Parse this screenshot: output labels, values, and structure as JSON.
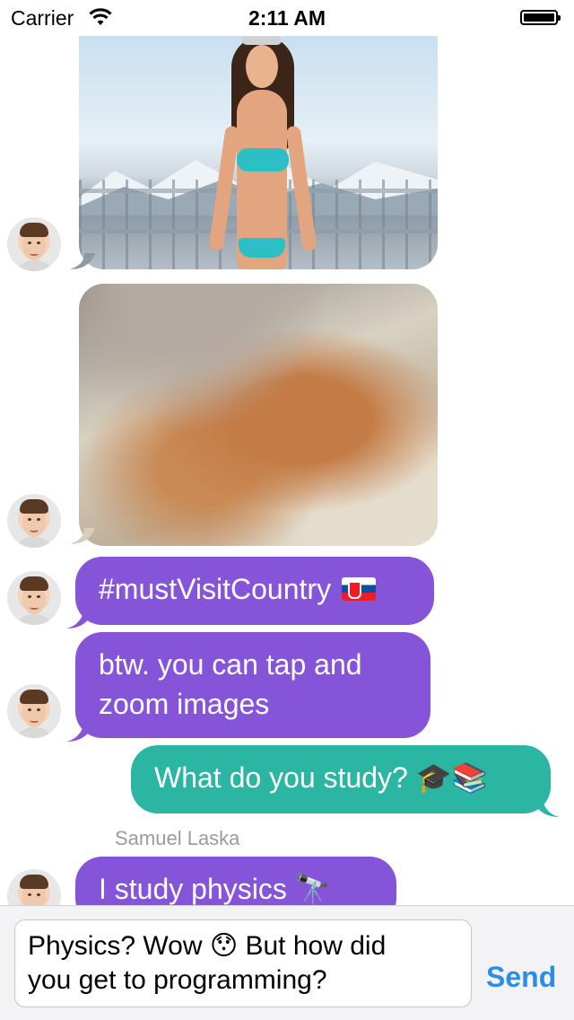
{
  "status_bar": {
    "carrier": "Carrier",
    "time": "2:11 AM",
    "icons": [
      "wifi-icon",
      "battery-icon"
    ]
  },
  "messages": [
    {
      "type": "image",
      "direction": "incoming",
      "subject": "skier-photo"
    },
    {
      "type": "image",
      "direction": "incoming",
      "subject": "food-photo"
    },
    {
      "type": "text",
      "direction": "incoming",
      "text": "#mustVisitCountry",
      "emoji": "slovakia-flag-icon"
    },
    {
      "type": "text",
      "direction": "incoming",
      "line1": "btw. you can tap and",
      "line2": "zoom images"
    },
    {
      "type": "text",
      "direction": "outgoing",
      "text": "What do you study?",
      "emoji": "🎓📚"
    },
    {
      "type": "text",
      "direction": "incoming",
      "sender": "Samuel Laska",
      "text": "I study physics",
      "emoji": "🔭"
    }
  ],
  "composer": {
    "line1": "Physics? Wow",
    "emoji": "😯",
    "line1b": "But how did",
    "line2": "you get to programming?",
    "send_label": "Send"
  },
  "colors": {
    "incoming_bubble": "#8654d8",
    "outgoing_bubble": "#2bb5a3",
    "send_button": "#2a8ee8"
  }
}
